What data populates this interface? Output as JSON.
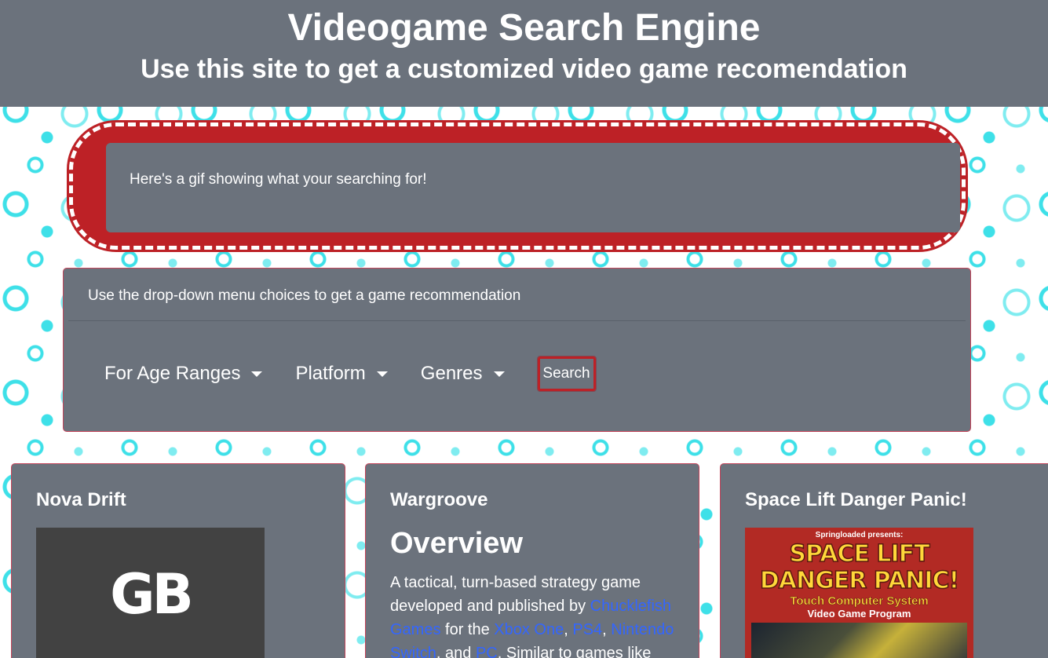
{
  "header": {
    "title": "Videogame Search Engine",
    "subtitle": "Use this site to get a customized video game recomendation"
  },
  "gif_panel": {
    "text": "Here's a gif showing what your searching for!"
  },
  "search_panel": {
    "heading": "Use the drop-down menu choices to get a game recommendation",
    "dropdowns": [
      {
        "label": "For Age Ranges"
      },
      {
        "label": "Platform"
      },
      {
        "label": "Genres"
      }
    ],
    "search_label": "Search"
  },
  "results": [
    {
      "title": "Nova Drift",
      "image_text": "GB"
    },
    {
      "title": "Wargroove",
      "heading": "Overview",
      "desc_parts": {
        "p1": "A tactical, turn-based strategy game developed and published by ",
        "link1": "Chucklefish Games",
        "p2": " for the ",
        "link2": "Xbox One",
        "p3": ", ",
        "link3": "PS4",
        "p4": ", ",
        "link4": "Nintendo Switch",
        "p5": ", and ",
        "link5": "PC",
        "p6": ". Similar to games like"
      }
    },
    {
      "title": "Space Lift Danger Panic!",
      "box_art": {
        "presents": "Springloaded presents:",
        "logo_line1": "SPACE LIFT",
        "logo_line2": "DANGER PANIC!",
        "touch": "Touch Computer System",
        "program": "Video Game Program"
      }
    }
  ],
  "colors": {
    "panel": "#6b727c",
    "accent_red": "#bd2126",
    "link": "#3366ff",
    "pattern": "#3ee0e8"
  }
}
